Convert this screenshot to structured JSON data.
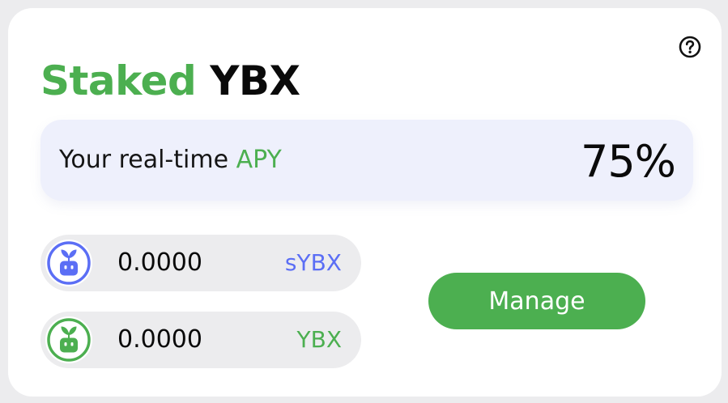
{
  "colors": {
    "green": "#4caf50",
    "blue": "#5b6ef5",
    "help_icon": "#111111"
  },
  "title": {
    "accent": "Staked",
    "rest": "YBX"
  },
  "help": {
    "icon": "question-circle-icon"
  },
  "apy": {
    "label_prefix": "Your real-time ",
    "label_accent": "APY",
    "value": "75%"
  },
  "balances": [
    {
      "amount": "0.0000",
      "symbol": "sYBX",
      "icon": "sprout-robot-icon",
      "color": "#5b6ef5"
    },
    {
      "amount": "0.0000",
      "symbol": "YBX",
      "icon": "sprout-robot-icon",
      "color": "#4caf50"
    }
  ],
  "actions": {
    "manage_label": "Manage"
  }
}
